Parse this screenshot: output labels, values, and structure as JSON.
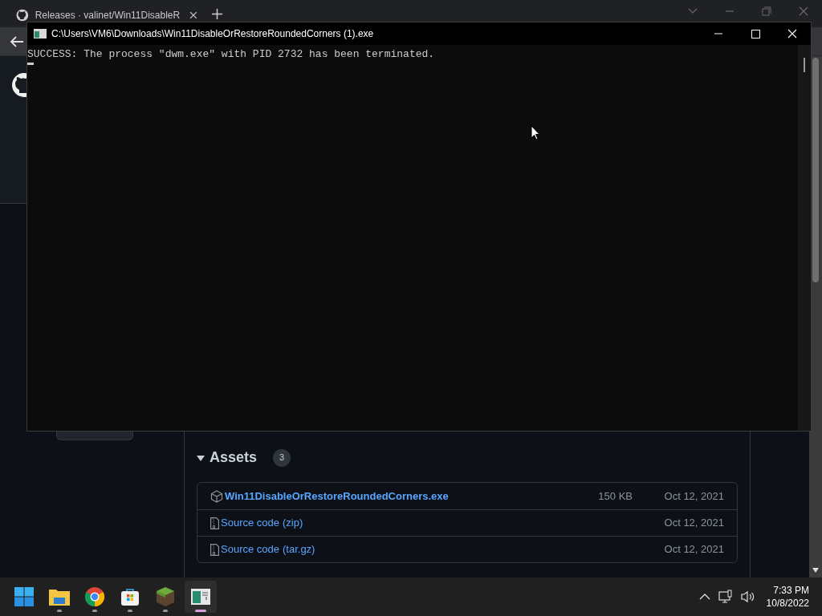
{
  "browser": {
    "tab": {
      "title": "Releases · valinet/Win11DisableR"
    }
  },
  "page": {
    "assets": {
      "heading": "Assets",
      "count": "3",
      "expanded": true,
      "items": [
        {
          "kind": "package",
          "name": "Win11DisableOrRestoreRoundedCorners.exe",
          "size": "150 KB",
          "date": "Oct 12, 2021"
        },
        {
          "kind": "archive",
          "name": "Source code",
          "suffix": "(zip)",
          "date": "Oct 12, 2021"
        },
        {
          "kind": "archive",
          "name": "Source code",
          "suffix": "(tar.gz)",
          "date": "Oct 12, 2021"
        }
      ]
    }
  },
  "console": {
    "title": "C:\\Users\\VM6\\Downloads\\Win11DisableOrRestoreRoundedCorners (1).exe",
    "lines": [
      "SUCCESS: The process \"dwm.exe\" with PID 2732 has been terminated."
    ]
  },
  "taskbar": {
    "apps": [
      {
        "kind": "start",
        "running": false,
        "selected": false
      },
      {
        "kind": "folder",
        "running": true,
        "selected": false
      },
      {
        "kind": "browser",
        "running": true,
        "selected": false
      },
      {
        "kind": "store",
        "running": true,
        "selected": false
      },
      {
        "kind": "block",
        "running": true,
        "selected": false
      },
      {
        "kind": "console",
        "running": true,
        "selected": true
      }
    ],
    "time": "7:33 PM",
    "date": "10/8/2022"
  }
}
